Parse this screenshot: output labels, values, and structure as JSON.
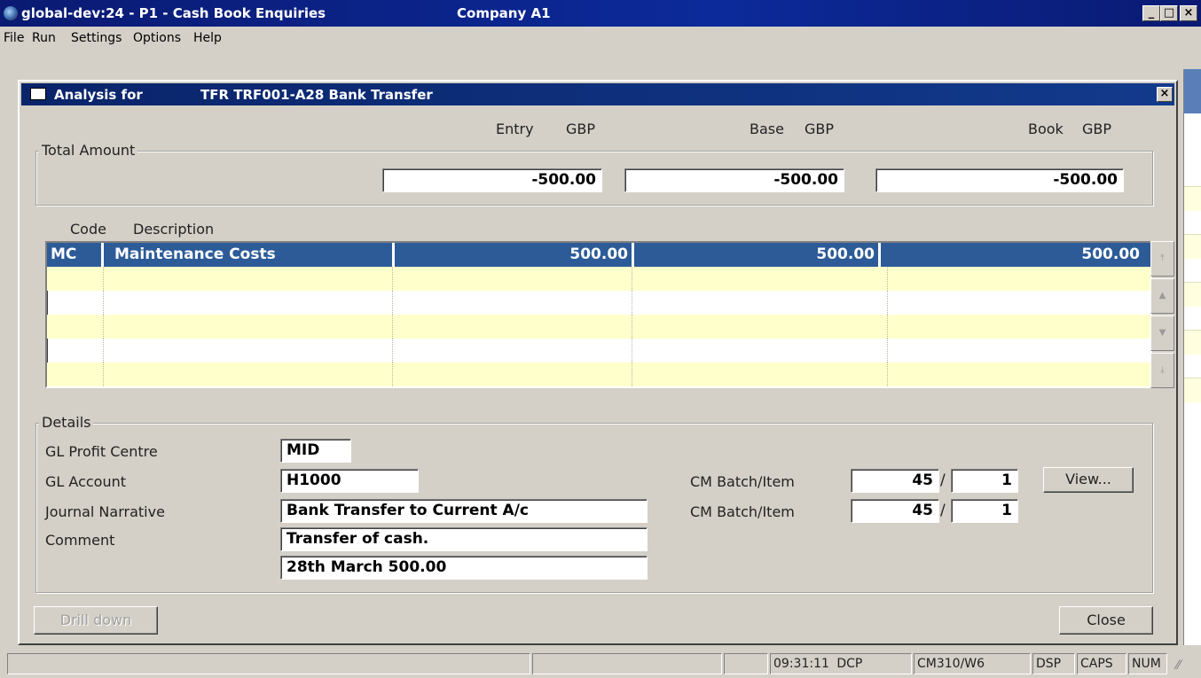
{
  "window": {
    "title": "global-dev:24 - P1 - Cash Book Enquiries",
    "company": "Company A1",
    "buttons": {
      "minimize": "_",
      "maximize": "□",
      "close": "×"
    }
  },
  "menu": [
    "File",
    "Run",
    "Settings",
    "Options",
    "Help"
  ],
  "dialog": {
    "label": "Analysis for",
    "reference": "TFR TRF001-A28 Bank Transfer",
    "close_glyph": "×"
  },
  "currencies": {
    "entry": "Entry",
    "entry_cur": "GBP",
    "base": "Base",
    "base_cur": "GBP",
    "book": "Book",
    "book_cur": "GBP"
  },
  "total_amount": {
    "title": "Total Amount",
    "entry": "-500.00",
    "base": "-500.00",
    "book": "-500.00"
  },
  "grid": {
    "headers": {
      "code": "Code",
      "description": "Description"
    },
    "rows": [
      {
        "code": "MC",
        "description": "Maintenance Costs",
        "entry": "500.00",
        "base": "500.00",
        "book": "500.00"
      }
    ],
    "scroll_icons": [
      "scroll-top-icon",
      "scroll-up-icon",
      "scroll-down-icon",
      "scroll-bottom-icon"
    ]
  },
  "details": {
    "title": "Details",
    "gl_profit_centre_label": "GL Profit Centre",
    "gl_profit_centre": "MID",
    "gl_account_label": "GL Account",
    "gl_account": "H1000",
    "journal_narrative_label": "Journal Narrative",
    "journal_narrative": "Bank Transfer to Current A/c",
    "comment_label": "Comment",
    "comment_1": "Transfer of cash.",
    "comment_2": "28th March 500.00",
    "cm_batch_label_1": "CM Batch/Item",
    "cm_batch_1": "45",
    "cm_item_1": "1",
    "cm_batch_label_2": "CM Batch/Item",
    "cm_batch_2": "45",
    "cm_item_2": "1",
    "separator": "/",
    "view_button": "View..."
  },
  "buttons": {
    "drill_down": "Drill down",
    "close": "Close"
  },
  "status": {
    "time": "09:31:11",
    "mode": "DCP",
    "program": "CM310/W6",
    "dsp": "DSP",
    "caps": "CAPS",
    "num": "NUM"
  }
}
